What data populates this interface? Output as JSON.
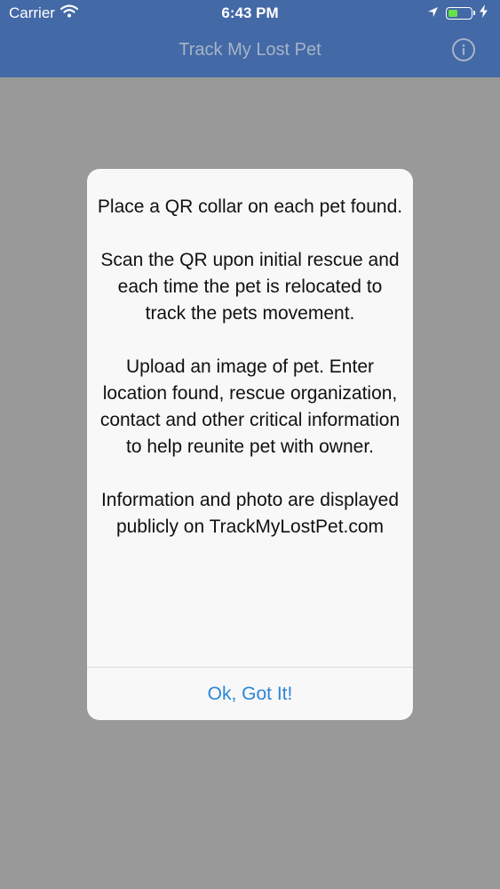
{
  "status_bar": {
    "carrier": "Carrier",
    "time": "6:43 PM",
    "battery_level": 0.45,
    "icons": [
      "wifi-icon",
      "location-arrow-icon",
      "battery-icon",
      "charging-bolt-icon"
    ]
  },
  "nav": {
    "title": "Track My Lost Pet",
    "info_icon": "info-icon"
  },
  "alert": {
    "paragraphs": [
      "Place a QR collar on each pet found.",
      "Scan the QR upon initial rescue and each time the pet is relocated to track the pets movement.",
      "Upload an image of pet. Enter location found, rescue organization, contact and other critical information to help reunite pet with owner.",
      "Information and photo are displayed publicly on TrackMyLostPet.com"
    ],
    "button_label": "Ok, Got It!"
  },
  "colors": {
    "nav_background": "#4369a6",
    "screen_overlay": "#999999",
    "alert_background": "#f8f8f8",
    "button_text": "#2c86d9"
  }
}
